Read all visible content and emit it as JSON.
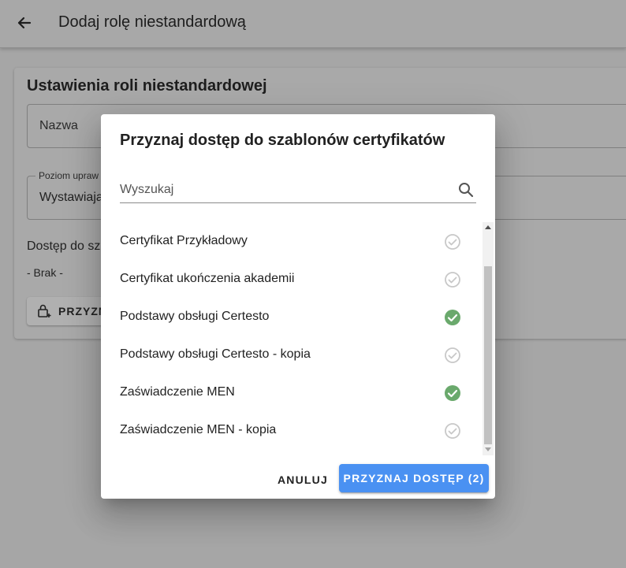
{
  "header": {
    "title": "Dodaj rolę niestandardową"
  },
  "card": {
    "title": "Ustawienia roli niestandardowej",
    "name_label": "Nazwa",
    "level_label": "Poziom upraw",
    "level_value": "Wystawiają",
    "access_label": "Dostęp do sz",
    "none_label": "- Brak -",
    "grant_button_label": "PRZYZN"
  },
  "dialog": {
    "title": "Przyznaj dostęp do szablonów certyfikatów",
    "search_placeholder": "Wyszukaj",
    "items": [
      {
        "label": "Certyfikat Przykładowy",
        "selected": false
      },
      {
        "label": "Certyfikat ukończenia akademii",
        "selected": false
      },
      {
        "label": "Podstawy obsługi Certesto",
        "selected": true
      },
      {
        "label": "Podstawy obsługi Certesto - kopia",
        "selected": false
      },
      {
        "label": "Zaświadczenie MEN",
        "selected": true
      },
      {
        "label": "Zaświadczenie MEN - kopia",
        "selected": false
      }
    ],
    "cancel_label": "ANULUJ",
    "grant_label": "PRZYZNAJ DOSTĘP (2)"
  },
  "colors": {
    "accent": "#4a91f2",
    "check_selected": "#6aa96c",
    "check_unselected": "#c8c8c8",
    "overlay": "#a6a6a6"
  },
  "icons": {
    "back": "arrow-left-icon",
    "search": "search-icon",
    "lock": "lock-plus-icon",
    "check": "check-circle-icon"
  }
}
